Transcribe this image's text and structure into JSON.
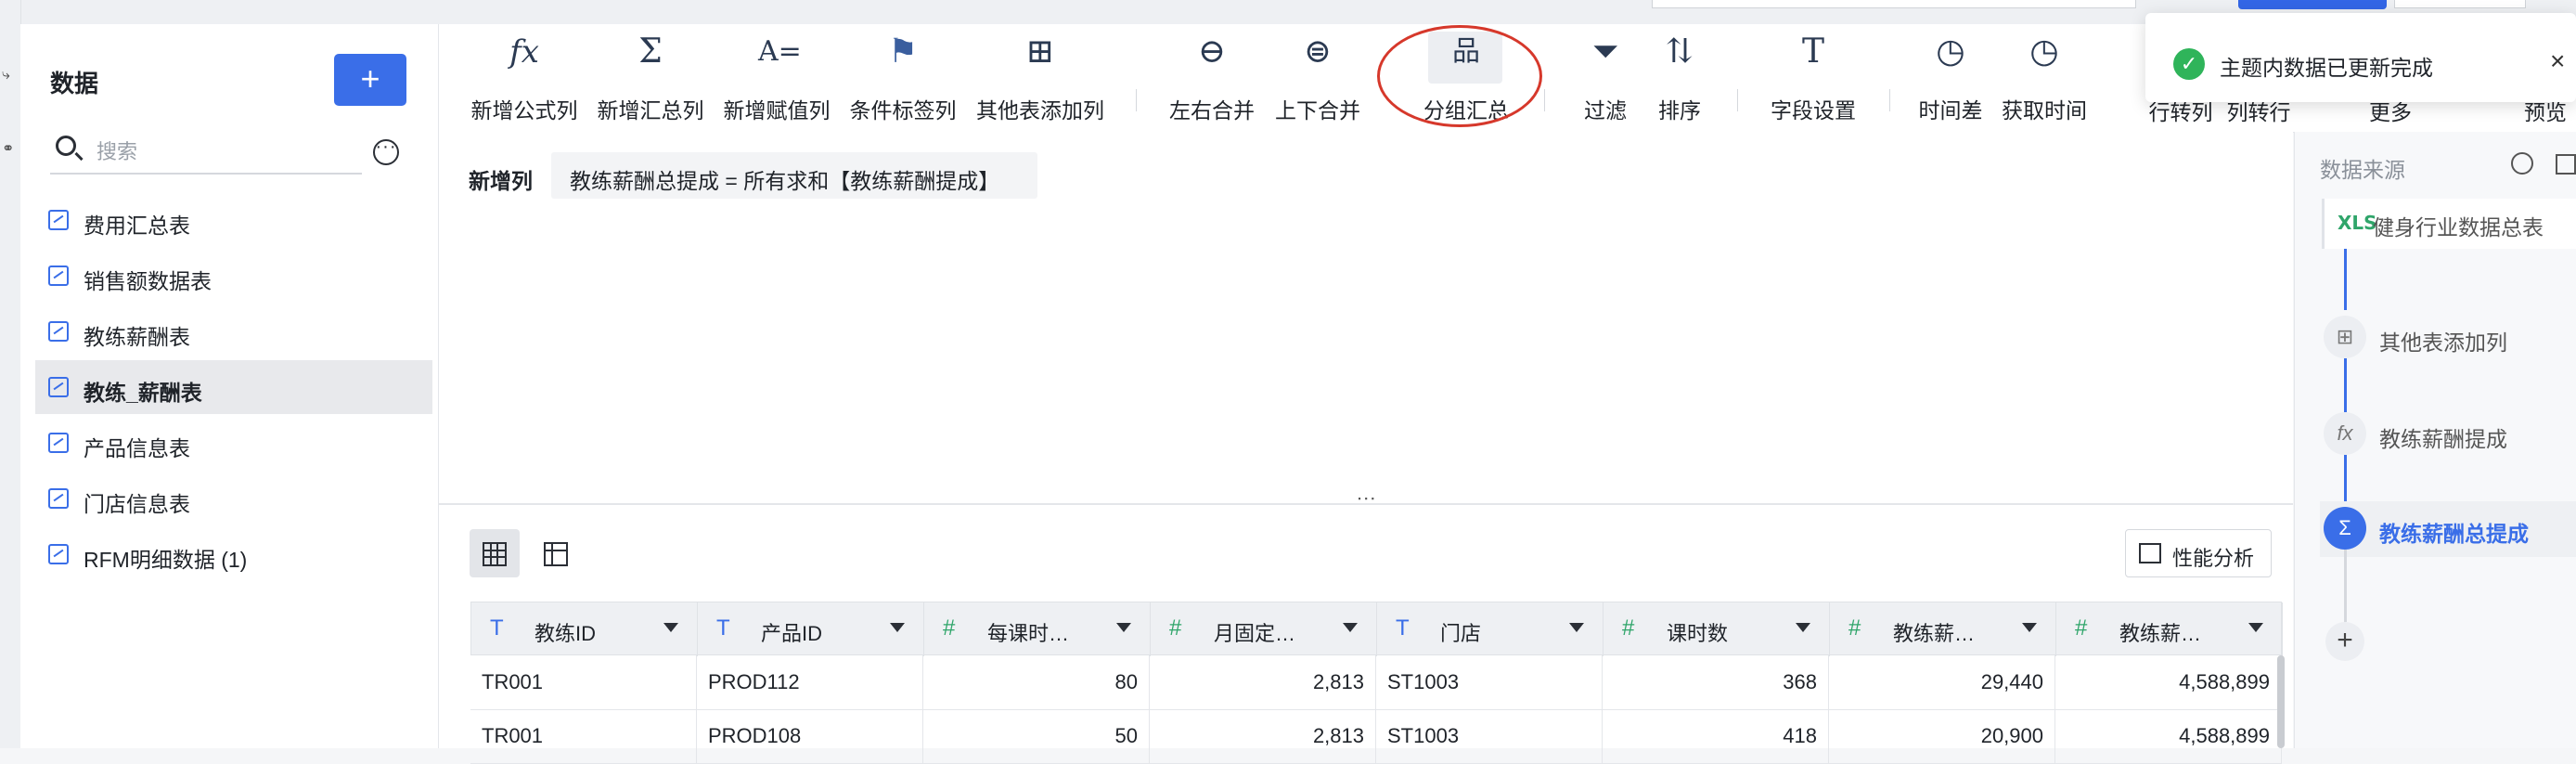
{
  "sidebar": {
    "title": "数据",
    "add_label": "+",
    "search_placeholder": "搜索",
    "items": [
      {
        "label": "费用汇总表"
      },
      {
        "label": "销售额数据表"
      },
      {
        "label": "教练薪酬表"
      },
      {
        "label": "教练_薪酬表"
      },
      {
        "label": "产品信息表"
      },
      {
        "label": "门店信息表"
      },
      {
        "label": "RFM明细数据 (1)"
      }
    ],
    "active_index": 3
  },
  "toolbar": {
    "tools": [
      {
        "label": "新增公式列",
        "icon": "fx-icon",
        "glyph": "fx"
      },
      {
        "label": "新增汇总列",
        "icon": "sigma-icon",
        "glyph": "Σ"
      },
      {
        "label": "新增赋值列",
        "icon": "assign-icon",
        "glyph": "A="
      },
      {
        "label": "条件标签列",
        "icon": "flag-icon",
        "glyph": "⚑"
      },
      {
        "label": "其他表添加列",
        "icon": "add-column-icon",
        "glyph": "⊞"
      },
      {
        "label": "左右合并",
        "icon": "merge-horizontal-icon",
        "glyph": "⊖"
      },
      {
        "label": "上下合并",
        "icon": "merge-vertical-icon",
        "glyph": "⊜"
      },
      {
        "label": "分组汇总",
        "icon": "group-icon",
        "glyph": "品"
      },
      {
        "label": "过滤",
        "icon": "filter-icon",
        "glyph": "⏷"
      },
      {
        "label": "排序",
        "icon": "sort-icon",
        "glyph": "⇅"
      },
      {
        "label": "字段设置",
        "icon": "field-settings-icon",
        "glyph": "T"
      },
      {
        "label": "时间差",
        "icon": "time-diff-icon",
        "glyph": "◷"
      },
      {
        "label": "获取时间",
        "icon": "get-time-icon",
        "glyph": "◷"
      },
      {
        "label": "行转列",
        "icon": "row-to-col-icon",
        "glyph": ""
      },
      {
        "label": "列转行",
        "icon": "col-to-row-icon",
        "glyph": ""
      },
      {
        "label": "更多",
        "icon": "more-icon",
        "glyph": ""
      },
      {
        "label": "预览",
        "icon": "preview-icon",
        "glyph": ""
      }
    ]
  },
  "toast": {
    "text": "主题内数据已更新完成",
    "close": "×",
    "check": "✓"
  },
  "formula": {
    "label": "新增列",
    "expression": "教练薪酬总提成 = 所有求和【教练薪酬提成】"
  },
  "splitter_handle": ":::",
  "perf_label": "性能分析",
  "table": {
    "columns": [
      {
        "label": "教练ID",
        "type": "T"
      },
      {
        "label": "产品ID",
        "type": "T"
      },
      {
        "label": "每课时…",
        "type": "#"
      },
      {
        "label": "月固定…",
        "type": "#"
      },
      {
        "label": "门店",
        "type": "T"
      },
      {
        "label": "课时数",
        "type": "#"
      },
      {
        "label": "教练薪…",
        "type": "#"
      },
      {
        "label": "教练薪…",
        "type": "#"
      }
    ],
    "rows": [
      [
        "TR001",
        "PROD112",
        "80",
        "2,813",
        "ST1003",
        "368",
        "29,440",
        "4,588,899"
      ],
      [
        "TR001",
        "PROD108",
        "50",
        "2,813",
        "ST1003",
        "418",
        "20,900",
        "4,588,899"
      ]
    ]
  },
  "right_panel": {
    "title": "数据来源",
    "source_badge": "XLS",
    "source_label": "健身行业数据总表",
    "steps": [
      {
        "label": "其他表添加列",
        "glyph": "⊞"
      },
      {
        "label": "教练薪酬提成",
        "glyph": "fx"
      },
      {
        "label": "教练薪酬总提成",
        "glyph": "Σ"
      }
    ],
    "add_label": "+"
  },
  "colors": {
    "accent": "#3a6ee8",
    "highlight_circle": "#d6382b",
    "success": "#2fb45a"
  }
}
